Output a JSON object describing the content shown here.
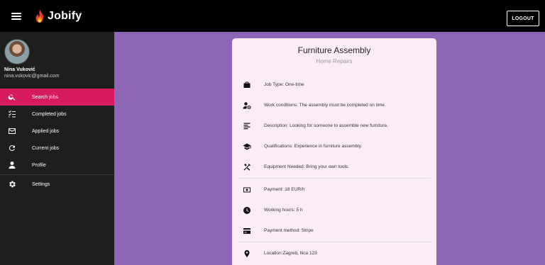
{
  "app": {
    "name": "Jobify",
    "logout_label": "LOGOUT"
  },
  "user": {
    "name": "Nina Vuković",
    "email": "nina.vukovic@gmail.com"
  },
  "sidebar": {
    "items": [
      {
        "label": "Search jobs",
        "icon": "search-icon",
        "active": true
      },
      {
        "label": "Completed jobs",
        "icon": "checklist-icon",
        "active": false
      },
      {
        "label": "Applied jobs",
        "icon": "mail-icon",
        "active": false
      },
      {
        "label": "Current jobs",
        "icon": "refresh-icon",
        "active": false
      },
      {
        "label": "Profile",
        "icon": "person-icon",
        "active": false
      },
      {
        "label": "Settings",
        "icon": "gear-icon",
        "active": false
      }
    ]
  },
  "job": {
    "title": "Furniture Assembly",
    "category": "Home Repairs",
    "details": [
      {
        "icon": "briefcase-icon",
        "text": "Job Type: One-time"
      },
      {
        "icon": "person-settings-icon",
        "text": "Work conditions: The assembly must be completed on time."
      },
      {
        "icon": "description-icon",
        "text": "Description: Looking for someone to assemble new furniture."
      },
      {
        "icon": "graduation-cap-icon",
        "text": "Qualifications: Experience in furniture assembly."
      },
      {
        "icon": "tools-icon",
        "text": "Equipment Needed: Bring your own tools."
      },
      {
        "icon": "money-icon",
        "text": "Payment: 18 EUR/h"
      },
      {
        "icon": "clock-icon",
        "text": "Working hours: 5 h"
      },
      {
        "icon": "credit-card-icon",
        "text": "Payment method: Stripe"
      },
      {
        "icon": "location-pin-icon",
        "text": "Location:Zagreb, Ilica 123"
      }
    ]
  },
  "colors": {
    "accent": "#d81b60",
    "background": "#8f65b8",
    "card": "#fcecf6",
    "sidebar": "#1e1e1e",
    "topbar": "#000000"
  }
}
